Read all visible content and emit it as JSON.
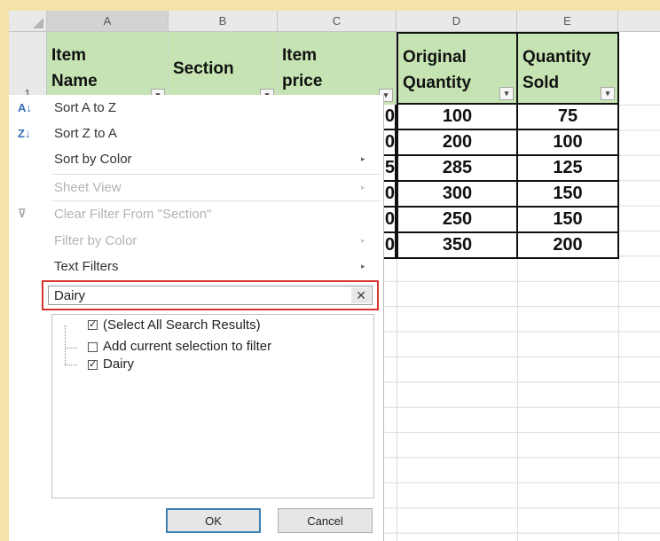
{
  "columns": [
    "A",
    "B",
    "C",
    "D",
    "E"
  ],
  "row_number": "1",
  "headers": {
    "a_line1": "Item",
    "a_line2": "Name",
    "b": "Section",
    "c_line1": "Item",
    "c_line2": "price",
    "d_line1": "Original",
    "d_line2": "Quantity",
    "e_line1": "Quantity",
    "e_line2": "Sold"
  },
  "filter_arrow": "▾",
  "table": {
    "price_fragments": [
      "0",
      "0",
      "5",
      "0",
      "0",
      "0"
    ],
    "original_quantity": [
      "100",
      "200",
      "285",
      "300",
      "250",
      "350"
    ],
    "quantity_sold": [
      "75",
      "100",
      "125",
      "150",
      "150",
      "200"
    ]
  },
  "menu": {
    "sort_a_z": "Sort A to Z",
    "sort_z_a": "Sort Z to A",
    "sort_by_color": "Sort by Color",
    "sheet_view": "Sheet View",
    "clear_filter": "Clear Filter From \"Section\"",
    "filter_by_color": "Filter by Color",
    "text_filters": "Text Filters",
    "submenu_arrow": "▸",
    "search_value": "Dairy",
    "search_clear": "✕",
    "options": [
      {
        "label": "(Select All Search Results)",
        "checked": true
      },
      {
        "label": "Add current selection to filter",
        "checked": false
      },
      {
        "label": "Dairy",
        "checked": true
      }
    ],
    "ok_label": "OK",
    "cancel_label": "Cancel"
  },
  "colors": {
    "header_fill": "#c6e4b3",
    "highlight_border": "#d9352e",
    "ok_border": "#3c7fb1"
  }
}
